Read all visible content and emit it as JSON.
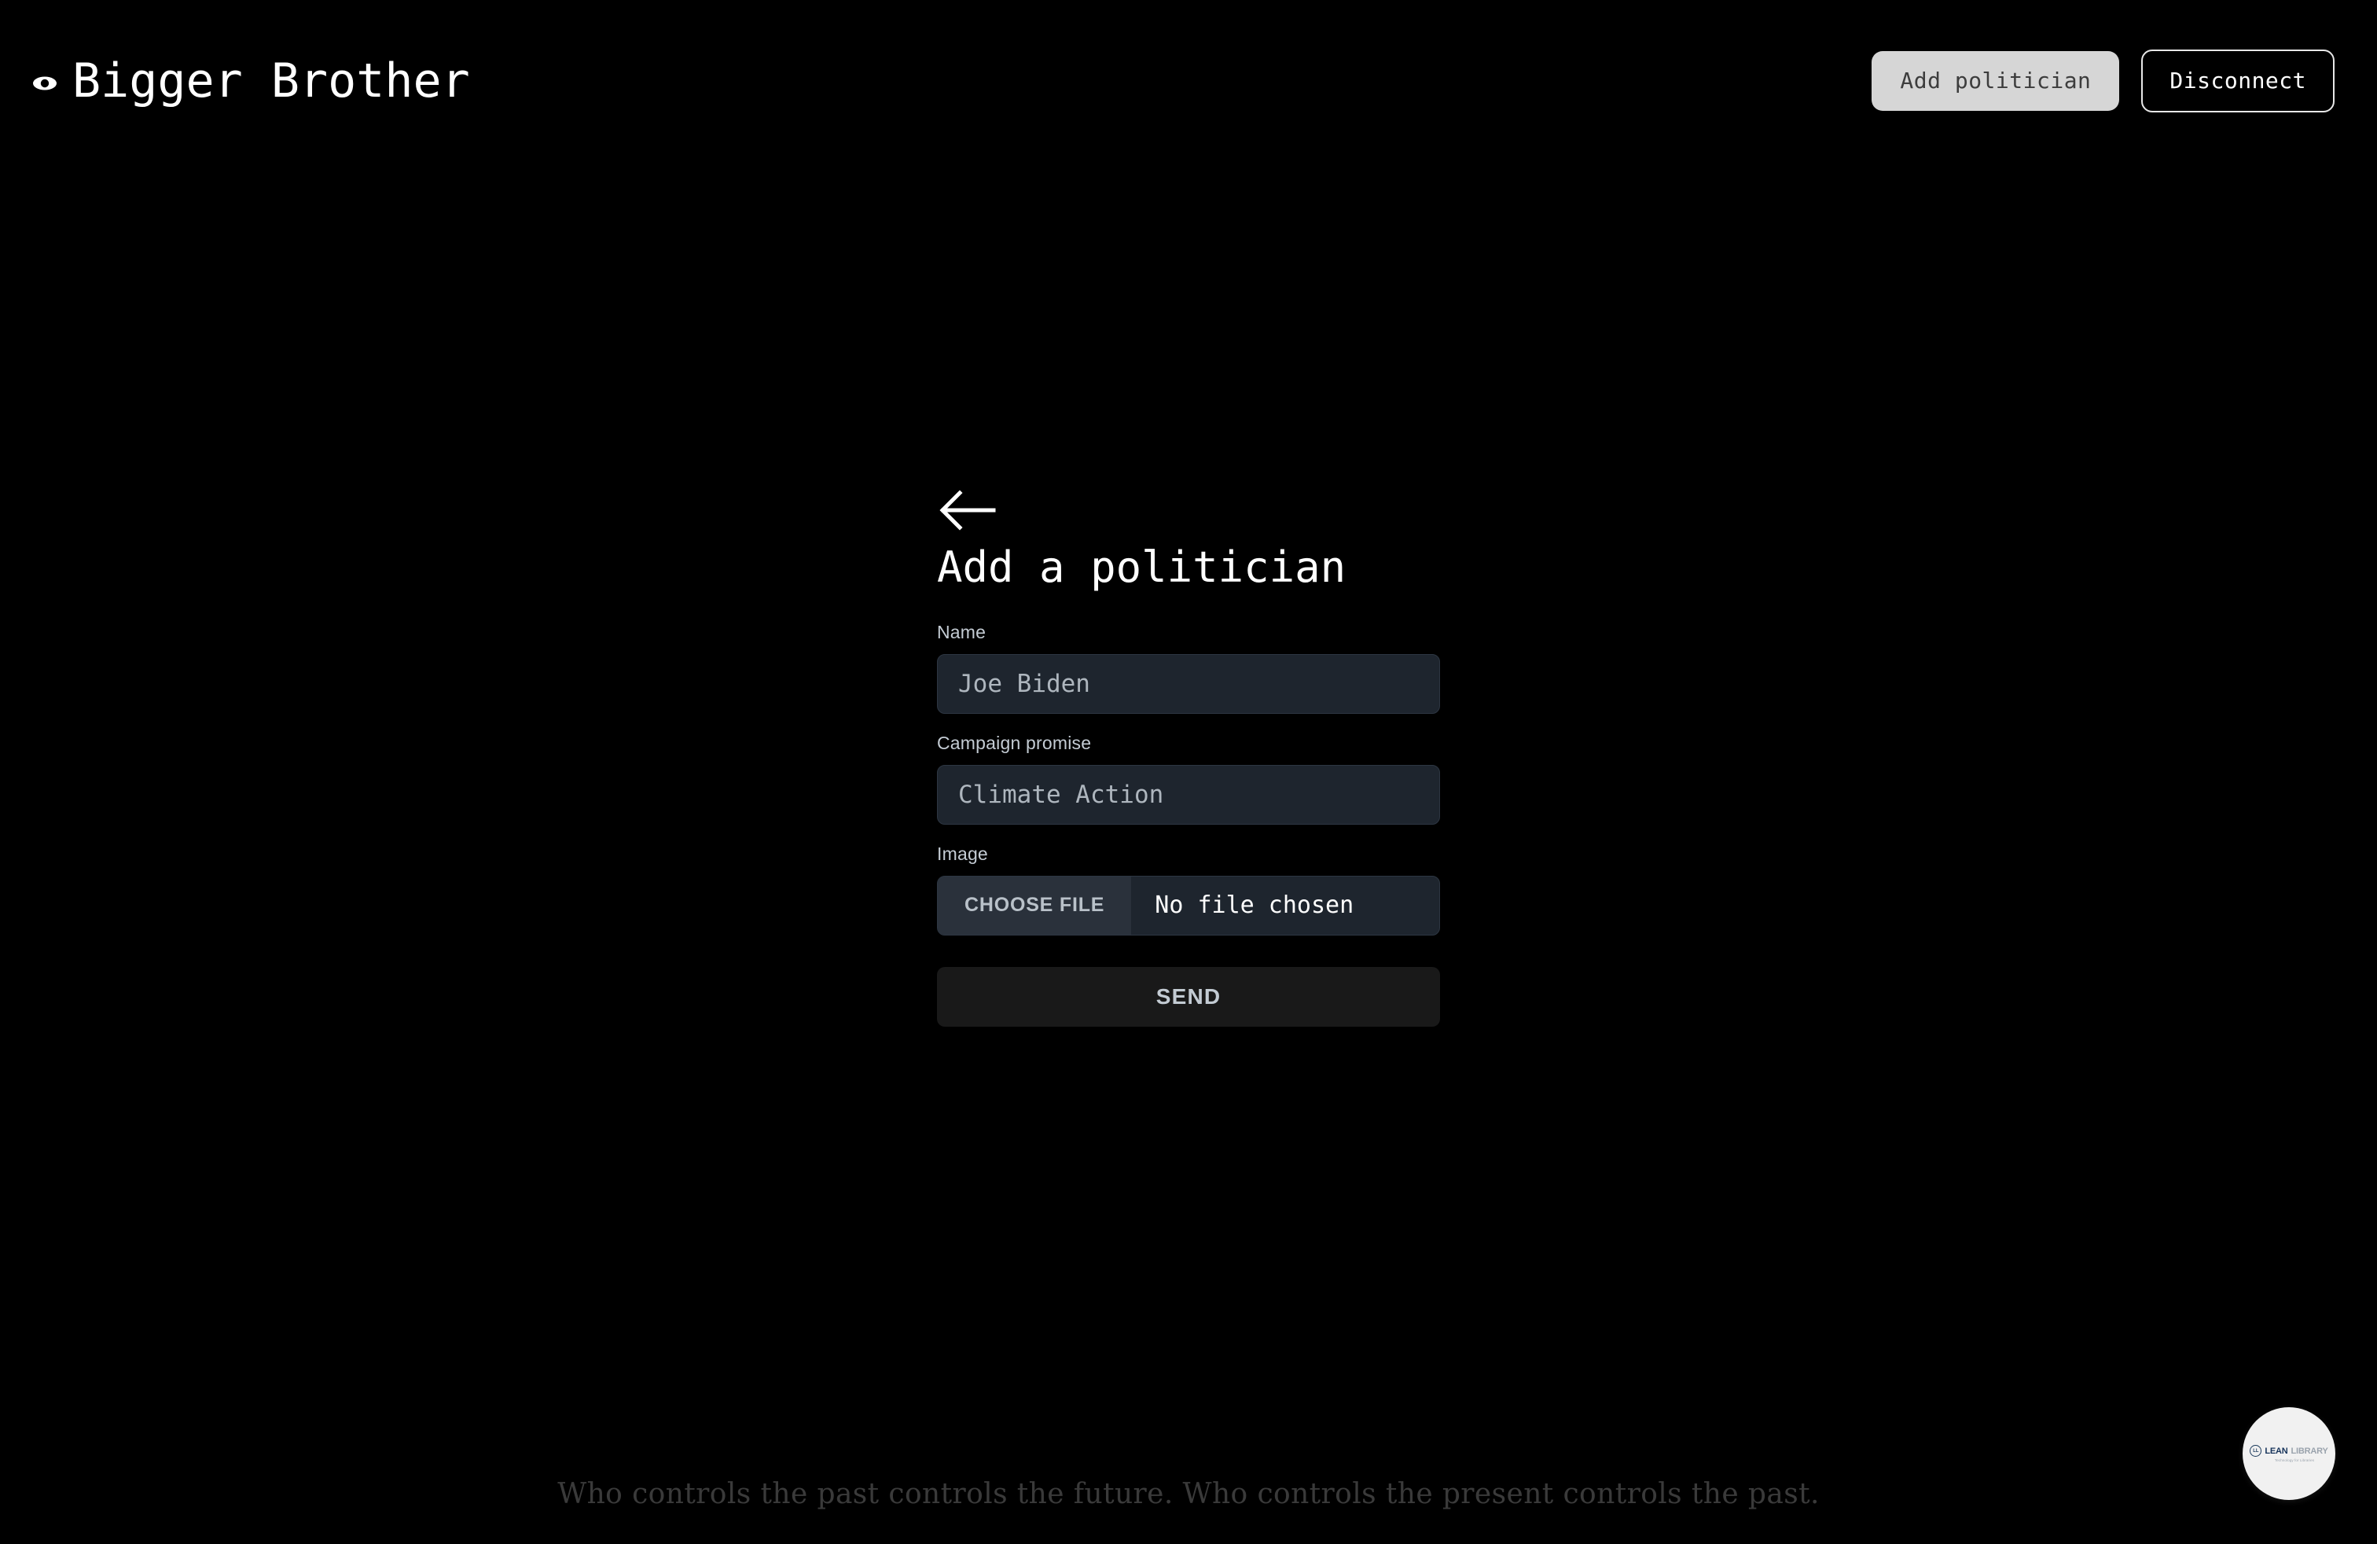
{
  "header": {
    "brand_title": "Bigger Brother",
    "brand_icon": "eye-icon",
    "add_politician_label": "Add politician",
    "disconnect_label": "Disconnect"
  },
  "main": {
    "back_icon": "arrow-left-icon",
    "page_title": "Add a politician",
    "fields": {
      "name": {
        "label": "Name",
        "placeholder": "Joe Biden",
        "value": ""
      },
      "campaign_promise": {
        "label": "Campaign promise",
        "placeholder": "Climate Action",
        "value": ""
      },
      "image": {
        "label": "Image",
        "choose_file_label": "CHOOSE FILE",
        "file_status": "No file chosen"
      }
    },
    "submit_label": "SEND"
  },
  "footer": {
    "quote": "Who controls the past controls the future. Who controls the present controls the past."
  },
  "badge": {
    "word_1": "LEAN",
    "word_2": "LIBRARY",
    "mark": "LL",
    "tagline": "Technology for Libraries"
  },
  "colors": {
    "background": "#000000",
    "input_background": "#1e252e",
    "file_button_background": "#2a313b",
    "send_button_background": "#191919",
    "accent_light": "#d6d6d6",
    "text_primary": "#ffffff",
    "text_muted": "#aeb6be",
    "footer_text": "#3a3a3a"
  }
}
